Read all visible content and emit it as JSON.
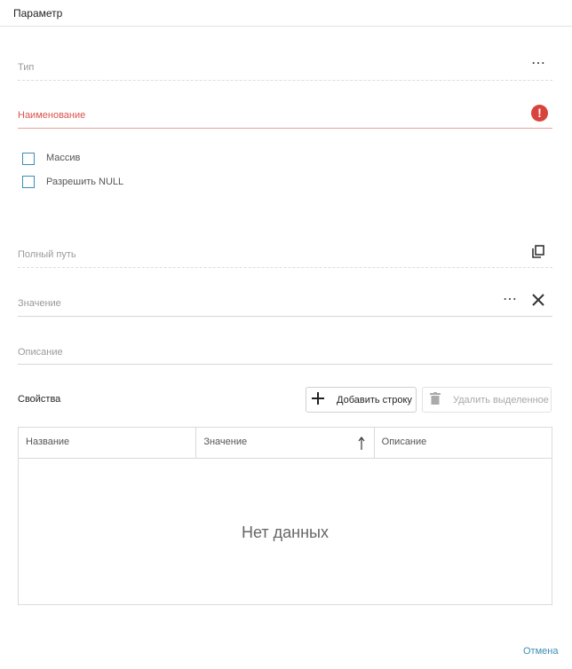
{
  "dialog": {
    "title": "Параметр"
  },
  "fields": {
    "type_label": "Тип",
    "name_label": "Наименование",
    "array_label": "Массив",
    "allow_null_label": "Разрешить NULL",
    "full_path_label": "Полный путь",
    "value_label": "Значение",
    "description_label": "Описание"
  },
  "properties": {
    "title": "Свойства",
    "add_row_label": "Добавить строку",
    "delete_selected_label": "Удалить выделенное",
    "columns": [
      "Название",
      "Значение",
      "Описание"
    ],
    "empty_text": "Нет данных"
  },
  "footer": {
    "cancel_label": "Отмена"
  },
  "icons": {
    "ellipsis": "more-icon",
    "error": "error-icon",
    "copy": "copy-icon",
    "clear": "close-icon",
    "add": "plus-icon",
    "delete": "trash-icon",
    "sort": "sort-arrow-icon"
  },
  "colors": {
    "error": "#d9433d",
    "accent": "#3a8fb7"
  }
}
